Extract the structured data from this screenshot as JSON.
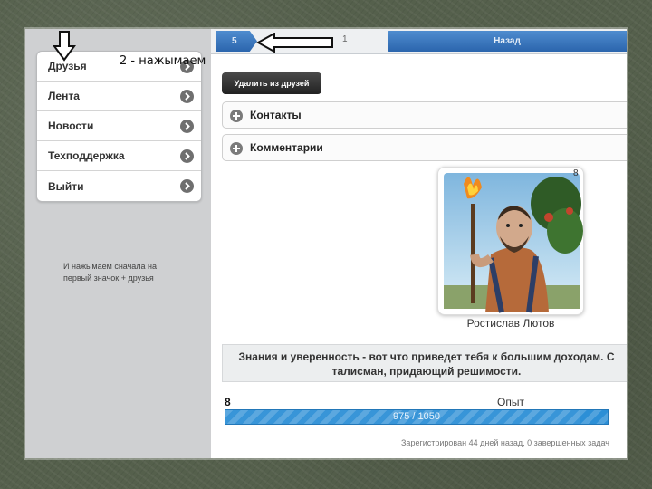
{
  "menu": {
    "items": [
      {
        "label": "Друзья"
      },
      {
        "label": "Лента"
      },
      {
        "label": "Новости"
      },
      {
        "label": "Техподдержка"
      },
      {
        "label": "Выйти"
      }
    ]
  },
  "annotations": {
    "inline_note": "2 - нажымаем",
    "side_note": "И нажымаем сначала на первый значок + друзья"
  },
  "breadcrumb": {
    "current": "5",
    "next": "1",
    "back_label": "Назад"
  },
  "actions": {
    "remove_friend_label": "Удалить из друзей"
  },
  "sections": [
    {
      "label": "Контакты"
    },
    {
      "label": "Комментарии"
    }
  ],
  "profile": {
    "level_badge": "8",
    "name": "Ростислав Лютов",
    "quote_line1": "Знания и уверенность - вот что приведет тебя к большим доходам. С",
    "quote_line2": "талисман, придающий решимости.",
    "level": "8",
    "xp_label": "Опыт",
    "xp_text": "975 / 1050",
    "xp_progress": 0.93,
    "registered_text": "Зарегистрирован 44 дней назад, 0 завершенных задач"
  },
  "colors": {
    "accent_blue": "#2b65ad",
    "xp_bar": "#2c8fd6",
    "sidebar_bg": "#cfd0d2",
    "backdrop": "#55604c"
  },
  "icons": {
    "menu_chevron": "chevron-right-icon",
    "section_plus": "plus-circle-icon",
    "annotation_down": "down-arrow-icon",
    "annotation_left": "left-arrow-icon"
  }
}
